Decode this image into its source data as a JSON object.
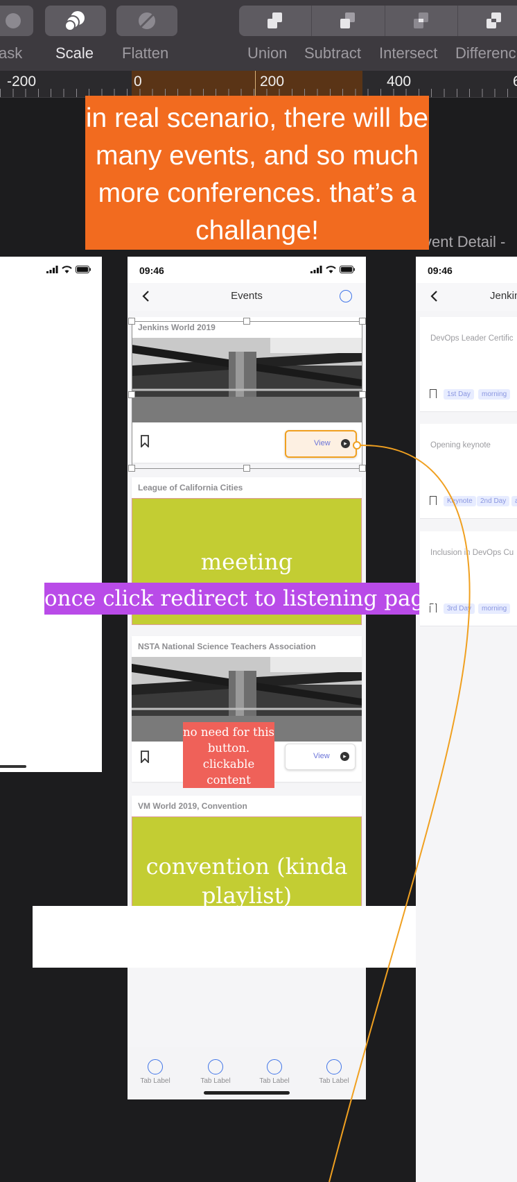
{
  "toolbar": {
    "tools": [
      {
        "label": "ask",
        "icon": "mask-icon"
      },
      {
        "label": "Scale",
        "icon": "scale-icon"
      },
      {
        "label": "Flatten",
        "icon": "flatten-icon"
      },
      {
        "label": "Union",
        "icon": "union-icon"
      },
      {
        "label": "Subtract",
        "icon": "subtract-icon"
      },
      {
        "label": "Intersect",
        "icon": "intersect-icon"
      },
      {
        "label": "Differenc",
        "icon": "difference-icon"
      }
    ]
  },
  "ruler": {
    "labels": [
      "-200",
      "0",
      "200",
      "400",
      "6"
    ]
  },
  "notes": {
    "orange": "in real scenario, there will be many events, and so much more conferences. that’s a challange!",
    "purple": "once click redirect to listening page",
    "red": "no need for this button. clickable content"
  },
  "artboards": {
    "right_title": "vent Detail -"
  },
  "main": {
    "time": "09:46",
    "nav_title": "Events",
    "cards": [
      {
        "title": "Jenkins World 2019",
        "button": "View"
      },
      {
        "title": "League of California Cities",
        "overlay_text": "meeting"
      },
      {
        "title": "NSTA National Science Teachers Association",
        "button": "View"
      },
      {
        "title": "VM World 2019, Convention",
        "overlay_text": "convention (kinda playlist)"
      }
    ],
    "tabs": [
      "Tab Label",
      "Tab Label",
      "Tab Label",
      "Tab Label"
    ]
  },
  "detail": {
    "time": "09:46",
    "nav_title": "Jenkin",
    "items": [
      {
        "title": "DevOps Leader Certific",
        "tags": [
          "1st Day",
          "morning"
        ]
      },
      {
        "title": "Opening keynote",
        "tags": [
          "Keynote",
          "2nd Day",
          "af"
        ]
      },
      {
        "title": "Inclusion in DevOps Cu",
        "tags": [
          "3rd Day",
          "morning"
        ]
      }
    ]
  },
  "colors": {
    "orange_note": "#f26b1f",
    "purple_note": "#b94be8",
    "red_note": "#ef6159",
    "green_card": "#c3cd33",
    "accent_blue": "#3f74e8",
    "prototype_link": "#f0a020"
  }
}
